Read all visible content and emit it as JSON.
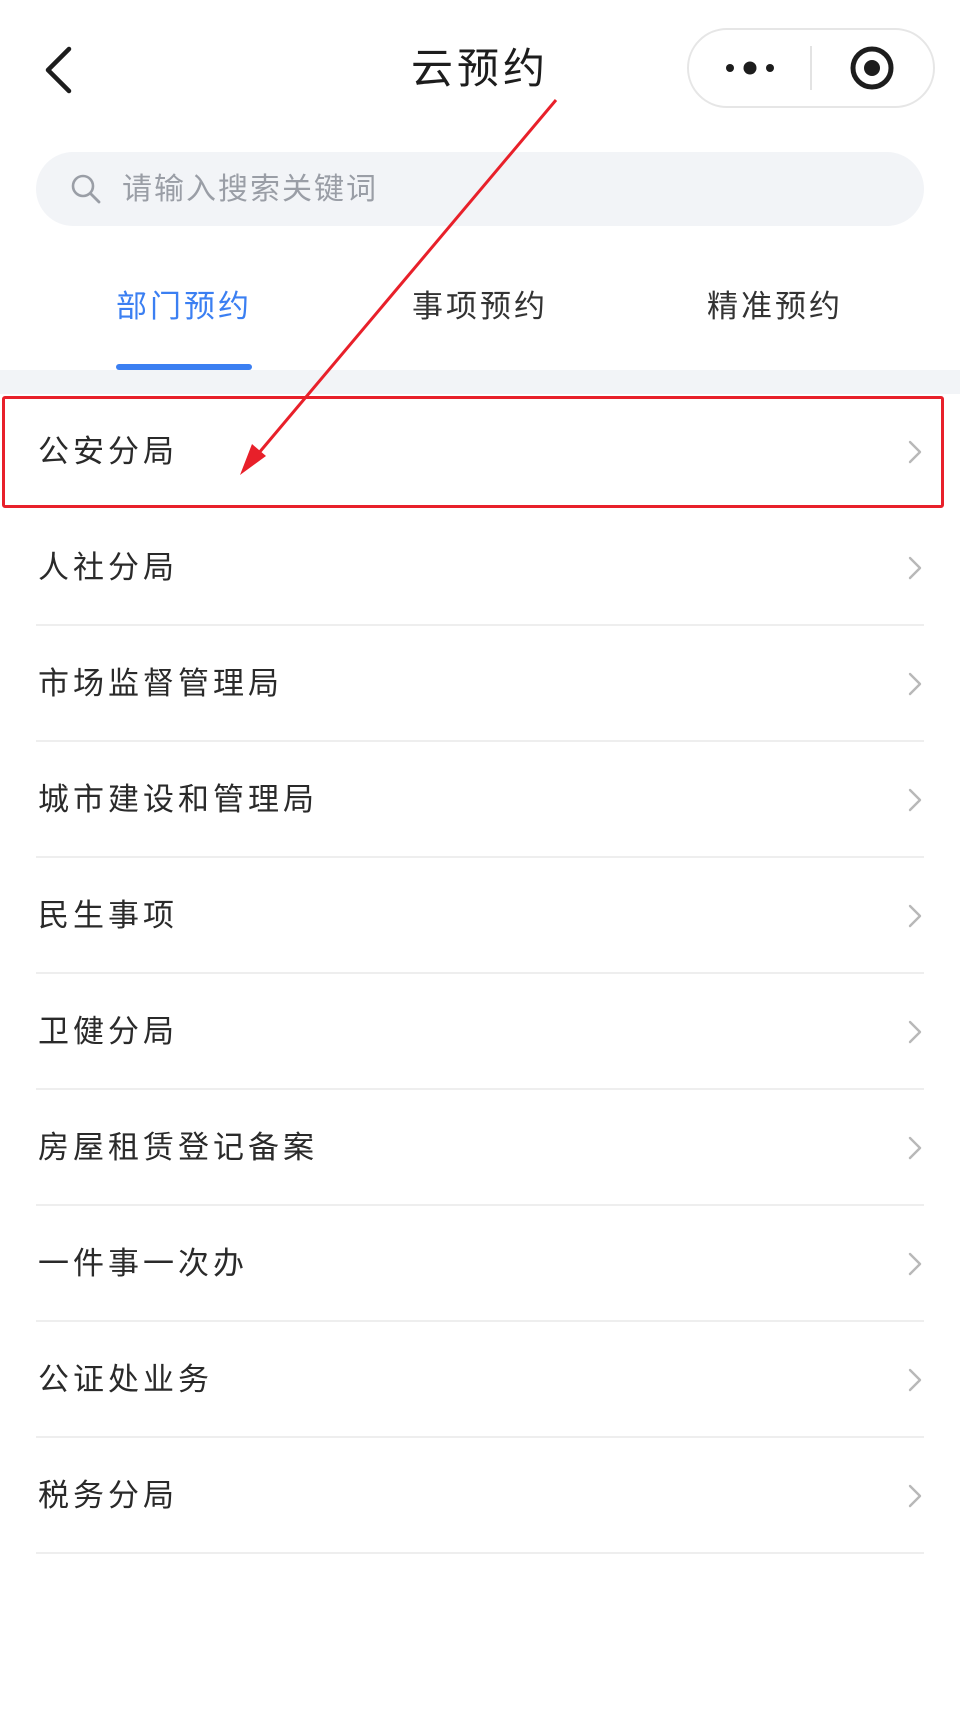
{
  "navbar": {
    "title": "云预约",
    "back_icon": "chevron-left-icon",
    "more_icon": "more-dots-icon",
    "close_icon": "target-circle-icon"
  },
  "search": {
    "placeholder": "请输入搜索关键词",
    "value": "",
    "icon": "search-icon"
  },
  "tabs": [
    {
      "label": "部门预约",
      "active": true
    },
    {
      "label": "事项预约",
      "active": false
    },
    {
      "label": "精准预约",
      "active": false
    }
  ],
  "list": {
    "items": [
      {
        "label": "公安分局"
      },
      {
        "label": "人社分局"
      },
      {
        "label": "市场监督管理局"
      },
      {
        "label": "城市建设和管理局"
      },
      {
        "label": "民生事项"
      },
      {
        "label": "卫健分局"
      },
      {
        "label": "房屋租赁登记备案"
      },
      {
        "label": "一件事一次办"
      },
      {
        "label": "公证处业务"
      },
      {
        "label": "税务分局"
      }
    ]
  },
  "annotation": {
    "highlighted_item": "公安分局",
    "color": "#e8202a"
  },
  "colors": {
    "accent": "#3b7ff2",
    "background_gray": "#f2f4f7",
    "annotation_red": "#e8202a"
  }
}
